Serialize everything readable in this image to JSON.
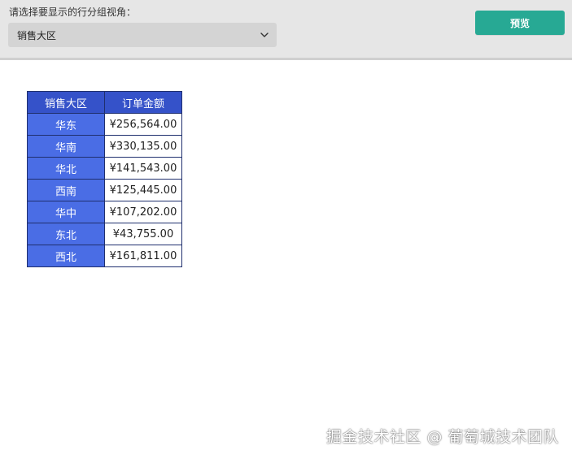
{
  "toolbar": {
    "prompt_label": "请选择要显示的行分组视角：",
    "select": {
      "selected_value": "销售大区",
      "icon": "chevron-down-icon"
    },
    "preview_button_label": "预览",
    "colors": {
      "background": "#e6e6e6",
      "button": "#27a994"
    }
  },
  "table": {
    "headers": [
      "销售大区",
      "订单金额"
    ],
    "rows": [
      {
        "region": "华东",
        "amount": "¥256,564.00"
      },
      {
        "region": "华南",
        "amount": "¥330,135.00"
      },
      {
        "region": "华北",
        "amount": "¥141,543.00"
      },
      {
        "region": "西南",
        "amount": "¥125,445.00"
      },
      {
        "region": "华中",
        "amount": "¥107,202.00"
      },
      {
        "region": "东北",
        "amount": "¥43,755.00"
      },
      {
        "region": "西北",
        "amount": "¥161,811.00"
      }
    ],
    "colors": {
      "header_bg": "#3552c9",
      "region_bg": "#4a6de5",
      "border": "#1f2f6e"
    }
  },
  "watermark": "掘金技术社区 @ 葡萄城技术团队"
}
